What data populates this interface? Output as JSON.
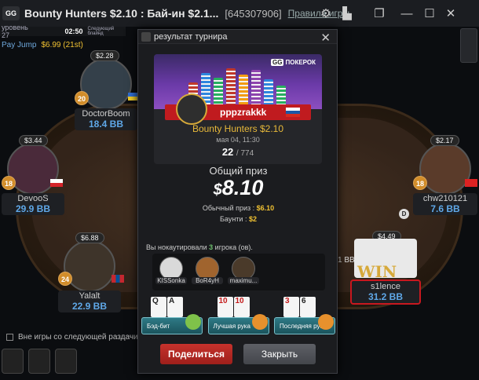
{
  "window": {
    "title": "Bounty Hunters $2.10 : Бай-ин $2.1...",
    "tournament_id": "[645307906]",
    "rules_link": "Правила игры"
  },
  "info": {
    "level": "уровень 27",
    "time": "02:50",
    "time_hint": "Следующий блайнд",
    "pay_jump_label": "Pay Jump",
    "pay_jump_value": "$6.99 (21st)"
  },
  "players": {
    "doctorboom": {
      "stack": "$2.28",
      "level": "20",
      "name": "DoctorBoom",
      "bb": "18.4 BB"
    },
    "devoos": {
      "stack": "$3.44",
      "level": "18",
      "name": "DevooS",
      "bb": "29.9 BB"
    },
    "chw210121": {
      "stack": "$2.17",
      "level": "18",
      "name": "chw210121",
      "bb": "7.6 BB"
    },
    "yalalt": {
      "stack": "$6.88",
      "level": "24",
      "name": "Yalalt",
      "bb": "22.9 BB"
    },
    "s1lence": {
      "stack": "$4.49",
      "name": "s1lence",
      "bb": "31.2 BB",
      "bet": "1 BB",
      "win": "WIN"
    }
  },
  "sitout": {
    "label": "Вне игры со следующей раздачи"
  },
  "modal": {
    "header": "результат турнира",
    "brand": "ПОКЕРОК",
    "brand_gg": "GG",
    "winner": "pppzrakkk",
    "tournament": "Bounty Hunters $2.10",
    "date": "мая 04, 11:30",
    "place": "22",
    "of_total": "/ 774",
    "prize_label": "Общий приз",
    "prize_currency": "$",
    "prize_amount": "8.10",
    "regular_label": "Обычный приз :",
    "regular_value": "$6.10",
    "bounty_label": "Баунти :",
    "bounty_value": "$2",
    "ko_prefix": "Вы нокаутировали",
    "ko_count": "3",
    "ko_suffix": "игрока (ов).",
    "knocked": [
      "KISSonka",
      "BoR4yH",
      "maximu..."
    ],
    "achievements": [
      {
        "label": "Бэд-бит",
        "cards": [
          "Q",
          "A"
        ]
      },
      {
        "label": "Лучшая рука",
        "cards": [
          "10",
          "10"
        ]
      },
      {
        "label": "Последняя рука",
        "cards": [
          "3",
          "6"
        ]
      }
    ],
    "share": "Поделиться",
    "close": "Закрыть"
  },
  "colors": {
    "accent_red": "#c01b1f",
    "gold": "#e8b93a",
    "bb_blue": "#5fa8e8"
  }
}
